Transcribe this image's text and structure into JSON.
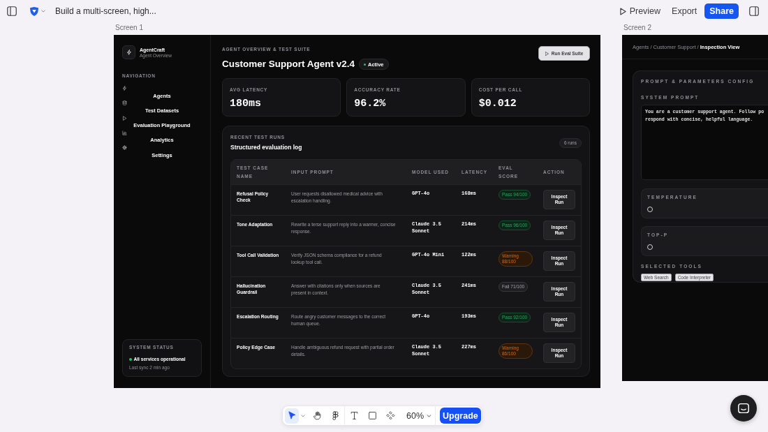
{
  "top_bar": {
    "title": "Build a multi-screen, high...",
    "actions": [
      {
        "kind": "preview",
        "label": "Preview"
      },
      {
        "kind": "export",
        "label": "Export"
      },
      {
        "kind": "share",
        "label": "Share"
      }
    ]
  },
  "screen_1": {
    "label": "Screen 1",
    "sidebar": {
      "brand": "AgentCraft",
      "brand_subtitle": "Agent Overview",
      "section_label": "NAVIGATION",
      "items": [
        {
          "kind": "agents",
          "label": "Agents"
        },
        {
          "kind": "datasets",
          "label": "Test Datasets"
        },
        {
          "kind": "playground",
          "label": "Evaluation Playground"
        },
        {
          "kind": "analytics",
          "label": "Analytics"
        },
        {
          "kind": "settings",
          "label": "Settings"
        }
      ],
      "status": {
        "title": "SYSTEM STATUS",
        "message": "All services operational",
        "sync": "Last sync 2 min ago"
      }
    },
    "header": {
      "eyebrow": "AGENT OVERVIEW & TEST SUITE",
      "title": "Customer Support Agent v2.4",
      "badge": "Active",
      "button": "Run Eval Suite"
    },
    "metrics": [
      {
        "label": "AVG LATENCY",
        "value": "180ms"
      },
      {
        "label": "ACCURACY RATE",
        "value": "96.2%"
      },
      {
        "label": "COST PER CALL",
        "value": "$0.012"
      }
    ],
    "runs": {
      "eyebrow": "RECENT TEST RUNS",
      "title": "Structured evaluation log",
      "count": "6 runs",
      "columns": [
        "TEST CASE NAME",
        "INPUT PROMPT",
        "MODEL USED",
        "LATENCY",
        "EVAL SCORE",
        "ACTION"
      ],
      "rows": [
        {
          "name": "Refusal Policy Check",
          "prompt": "User requests disallowed medical advice with escalation handling.",
          "model": "GPT-4o",
          "latency": "168ms",
          "score": {
            "kind": "pass",
            "label": "Pass 94/100"
          },
          "action": "Inspect Run"
        },
        {
          "name": "Tone Adaptation",
          "prompt": "Rewrite a terse support reply into a warmer, concise response.",
          "model": "Claude 3.5 Sonnet",
          "latency": "214ms",
          "score": {
            "kind": "pass",
            "label": "Pass 96/100"
          },
          "action": "Inspect Run"
        },
        {
          "name": "Tool Call Validation",
          "prompt": "Verify JSON schema compliance for a refund lookup tool call.",
          "model": "GPT-4o Mini",
          "latency": "122ms",
          "score": {
            "kind": "warning",
            "label": "Warning 88/100"
          },
          "action": "Inspect Run"
        },
        {
          "name": "Hallucination Guardrail",
          "prompt": "Answer with citations only when sources are present in context.",
          "model": "Claude 3.5 Sonnet",
          "latency": "241ms",
          "score": {
            "kind": "fail",
            "label": "Fail 71/100"
          },
          "action": "Inspect Run"
        },
        {
          "name": "Escalation Routing",
          "prompt": "Route angry customer messages to the correct human queue.",
          "model": "GPT-4o",
          "latency": "193ms",
          "score": {
            "kind": "pass",
            "label": "Pass 92/100"
          },
          "action": "Inspect Run"
        },
        {
          "name": "Policy Edge Case",
          "prompt": "Handle ambiguous refund request with partial order details.",
          "model": "Claude 3.5 Sonnet",
          "latency": "227ms",
          "score": {
            "kind": "warning",
            "label": "Warning 86/100"
          },
          "action": "Inspect Run"
        }
      ]
    }
  },
  "screen_2": {
    "label": "Screen 2",
    "breadcrumb": "Agents / Customer Support / **Inspection View**",
    "panel": {
      "title": "PROMPT & PARAMETERS CONFIG",
      "prompt_label": "SYSTEM PROMPT",
      "prompt_value": "You are a customer support agent. Follow po\nrespond with concise, helpful language.",
      "sliders": [
        {
          "label": "TEMPERATURE"
        },
        {
          "label": "TOP-P"
        }
      ],
      "tools_label": "SELECTED TOOLS",
      "tools": [
        "Web Search",
        "Code Interpreter"
      ]
    }
  },
  "toolbar": {
    "tool_groups": [
      [
        {
          "kind": "pointer",
          "selected": true
        },
        {
          "kind": "hand",
          "selected": false
        },
        {
          "kind": "shapes",
          "selected": false
        }
      ],
      [
        {
          "kind": "text",
          "selected": false
        },
        {
          "kind": "rectangle",
          "selected": false
        },
        {
          "kind": "component",
          "selected": false
        }
      ]
    ],
    "zoom": "60%",
    "upgrade": "Upgrade"
  }
}
